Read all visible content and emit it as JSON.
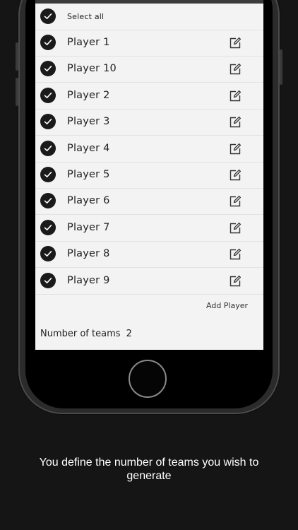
{
  "select_all": {
    "label": "Select all",
    "checked": true
  },
  "players": [
    {
      "name": "Player 1",
      "checked": true
    },
    {
      "name": "Player 10",
      "checked": true
    },
    {
      "name": "Player 2",
      "checked": true
    },
    {
      "name": "Player 3",
      "checked": true
    },
    {
      "name": "Player 4",
      "checked": true
    },
    {
      "name": "Player 5",
      "checked": true
    },
    {
      "name": "Player 6",
      "checked": true
    },
    {
      "name": "Player 7",
      "checked": true
    },
    {
      "name": "Player 8",
      "checked": true
    },
    {
      "name": "Player 9",
      "checked": true
    }
  ],
  "add_player_label": "Add Player",
  "teams": {
    "label": "Number of teams",
    "value": "2"
  },
  "caption": "You define the number of teams you wish to generate",
  "icons": {
    "check": "check-icon",
    "edit": "edit-icon"
  },
  "colors": {
    "background": "#151515",
    "screen": "#f3f3f3",
    "check_fill": "#1a1a1a",
    "caption_text": "#ffffff"
  }
}
